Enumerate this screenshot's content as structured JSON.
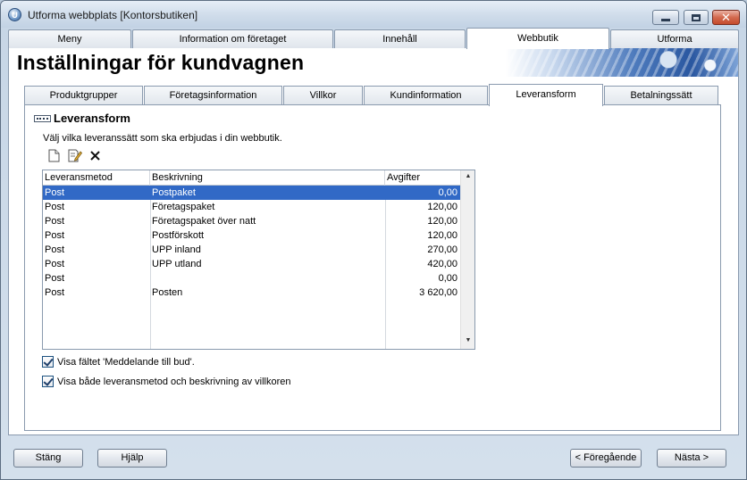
{
  "window": {
    "title": "Utforma webbplats [Kontorsbutiken]"
  },
  "main_tabs": [
    {
      "label": "Meny"
    },
    {
      "label": "Information om företaget"
    },
    {
      "label": "Innehåll"
    },
    {
      "label": "Webbutik"
    },
    {
      "label": "Utforma"
    }
  ],
  "page": {
    "title": "Inställningar för kundvagnen"
  },
  "sub_tabs": [
    {
      "label": "Produktgrupper"
    },
    {
      "label": "Företagsinformation"
    },
    {
      "label": "Villkor"
    },
    {
      "label": "Kundinformation"
    },
    {
      "label": "Leveransform"
    },
    {
      "label": "Betalningssätt"
    }
  ],
  "section": {
    "title": "Leveransform",
    "hint": "Välj vilka leveranssätt som ska erbjudas i din webbutik."
  },
  "toolbar": {
    "new_icon": "new-document-icon",
    "edit_icon": "edit-icon",
    "delete_icon": "delete-icon"
  },
  "table": {
    "headers": [
      "Leveransmetod",
      "Beskrivning",
      "Avgifter"
    ],
    "rows": [
      {
        "method": "Post",
        "description": "Postpaket",
        "fee": "0,00",
        "selected": true
      },
      {
        "method": "Post",
        "description": "Företagspaket",
        "fee": "120,00"
      },
      {
        "method": "Post",
        "description": "Företagspaket över natt",
        "fee": "120,00"
      },
      {
        "method": "Post",
        "description": "Postförskott",
        "fee": "120,00"
      },
      {
        "method": "Post",
        "description": "UPP inland",
        "fee": "270,00"
      },
      {
        "method": "Post",
        "description": "UPP utland",
        "fee": "420,00"
      },
      {
        "method": "Post",
        "description": "",
        "fee": "0,00"
      },
      {
        "method": "Post",
        "description": "Posten",
        "fee": "3 620,00"
      }
    ]
  },
  "options": {
    "show_message_field": {
      "label": "Visa fältet 'Meddelande till bud'.",
      "checked": true
    },
    "show_both": {
      "label": "Visa både leveransmetod och beskrivning av villkoren",
      "checked": true
    }
  },
  "buttons": {
    "close": "Stäng",
    "help": "Hjälp",
    "previous": "< Föregående",
    "next": "Nästa >"
  },
  "colors": {
    "selection": "#3169c6",
    "banner": "#2a57a0"
  }
}
